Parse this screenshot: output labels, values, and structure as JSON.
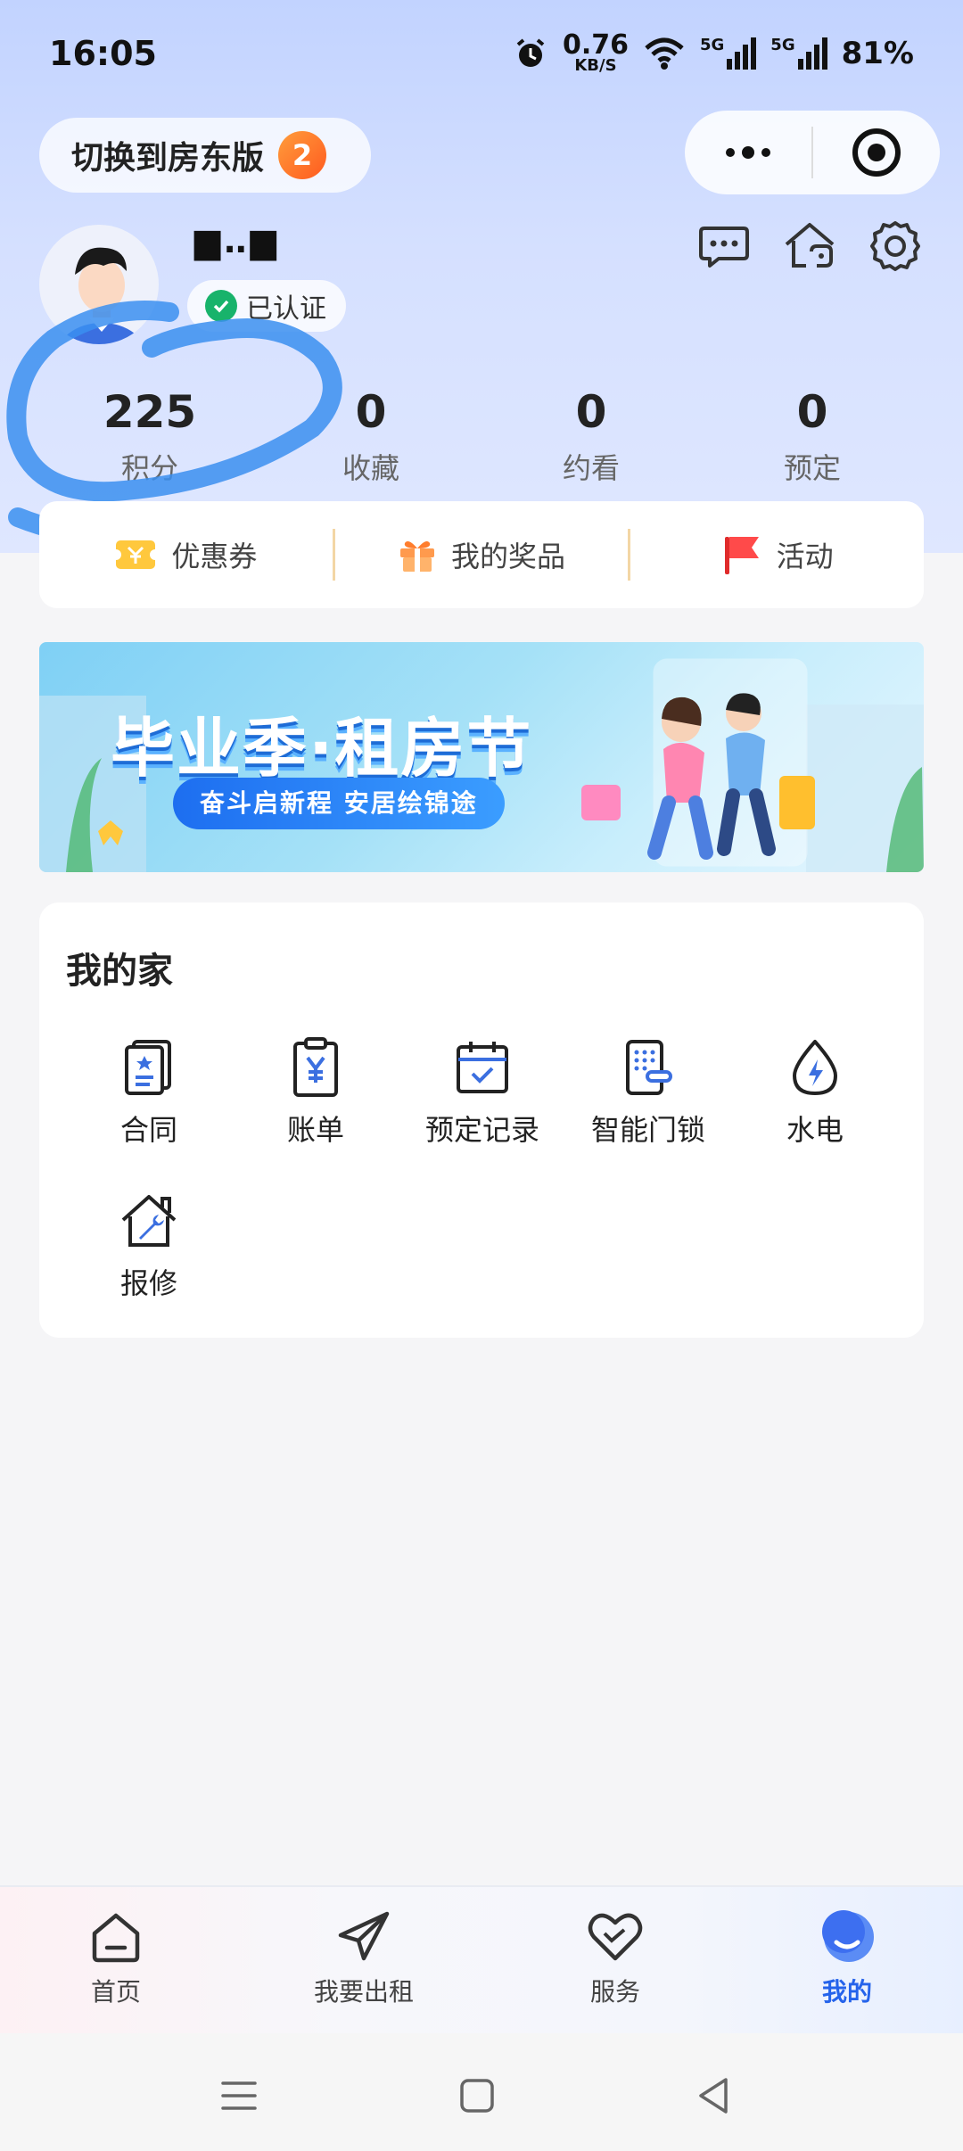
{
  "status_bar": {
    "time": "16:05",
    "net_speed_value": "0.76",
    "net_speed_unit": "KB/S",
    "signal1": "5G",
    "signal2": "5G",
    "battery": "81%"
  },
  "header": {
    "switch_label": "切换到房东版",
    "switch_badge": "2"
  },
  "profile": {
    "username": "▆‥▆",
    "verified_label": "已认证"
  },
  "stats": [
    {
      "value": "225",
      "label": "积分"
    },
    {
      "value": "0",
      "label": "收藏"
    },
    {
      "value": "0",
      "label": "约看"
    },
    {
      "value": "0",
      "label": "预定"
    }
  ],
  "quick_links": [
    {
      "label": "优惠券",
      "icon": "coupon-icon"
    },
    {
      "label": "我的奖品",
      "icon": "gift-icon"
    },
    {
      "label": "活动",
      "icon": "flag-icon"
    }
  ],
  "banner": {
    "title": "毕业季·租房节",
    "subtitle": "奋斗启新程 安居绘锦途"
  },
  "my_home": {
    "title": "我的家",
    "items": [
      {
        "label": "合同",
        "icon": "contract-icon"
      },
      {
        "label": "账单",
        "icon": "bill-icon"
      },
      {
        "label": "预定记录",
        "icon": "calendar-icon"
      },
      {
        "label": "智能门锁",
        "icon": "smart-lock-icon"
      },
      {
        "label": "水电",
        "icon": "utilities-icon"
      },
      {
        "label": "报修",
        "icon": "repair-icon"
      }
    ]
  },
  "tabbar": [
    {
      "label": "首页",
      "icon": "home-icon"
    },
    {
      "label": "我要出租",
      "icon": "send-icon"
    },
    {
      "label": "服务",
      "icon": "heart-icon"
    },
    {
      "label": "我的",
      "icon": "profile-icon",
      "active": true
    }
  ],
  "colors": {
    "accent": "#2563eb",
    "hero_bg": "#c8d7ff",
    "badge_orange": "#ff6a1f",
    "verified_green": "#18b36b",
    "flag_red": "#ff4040"
  }
}
